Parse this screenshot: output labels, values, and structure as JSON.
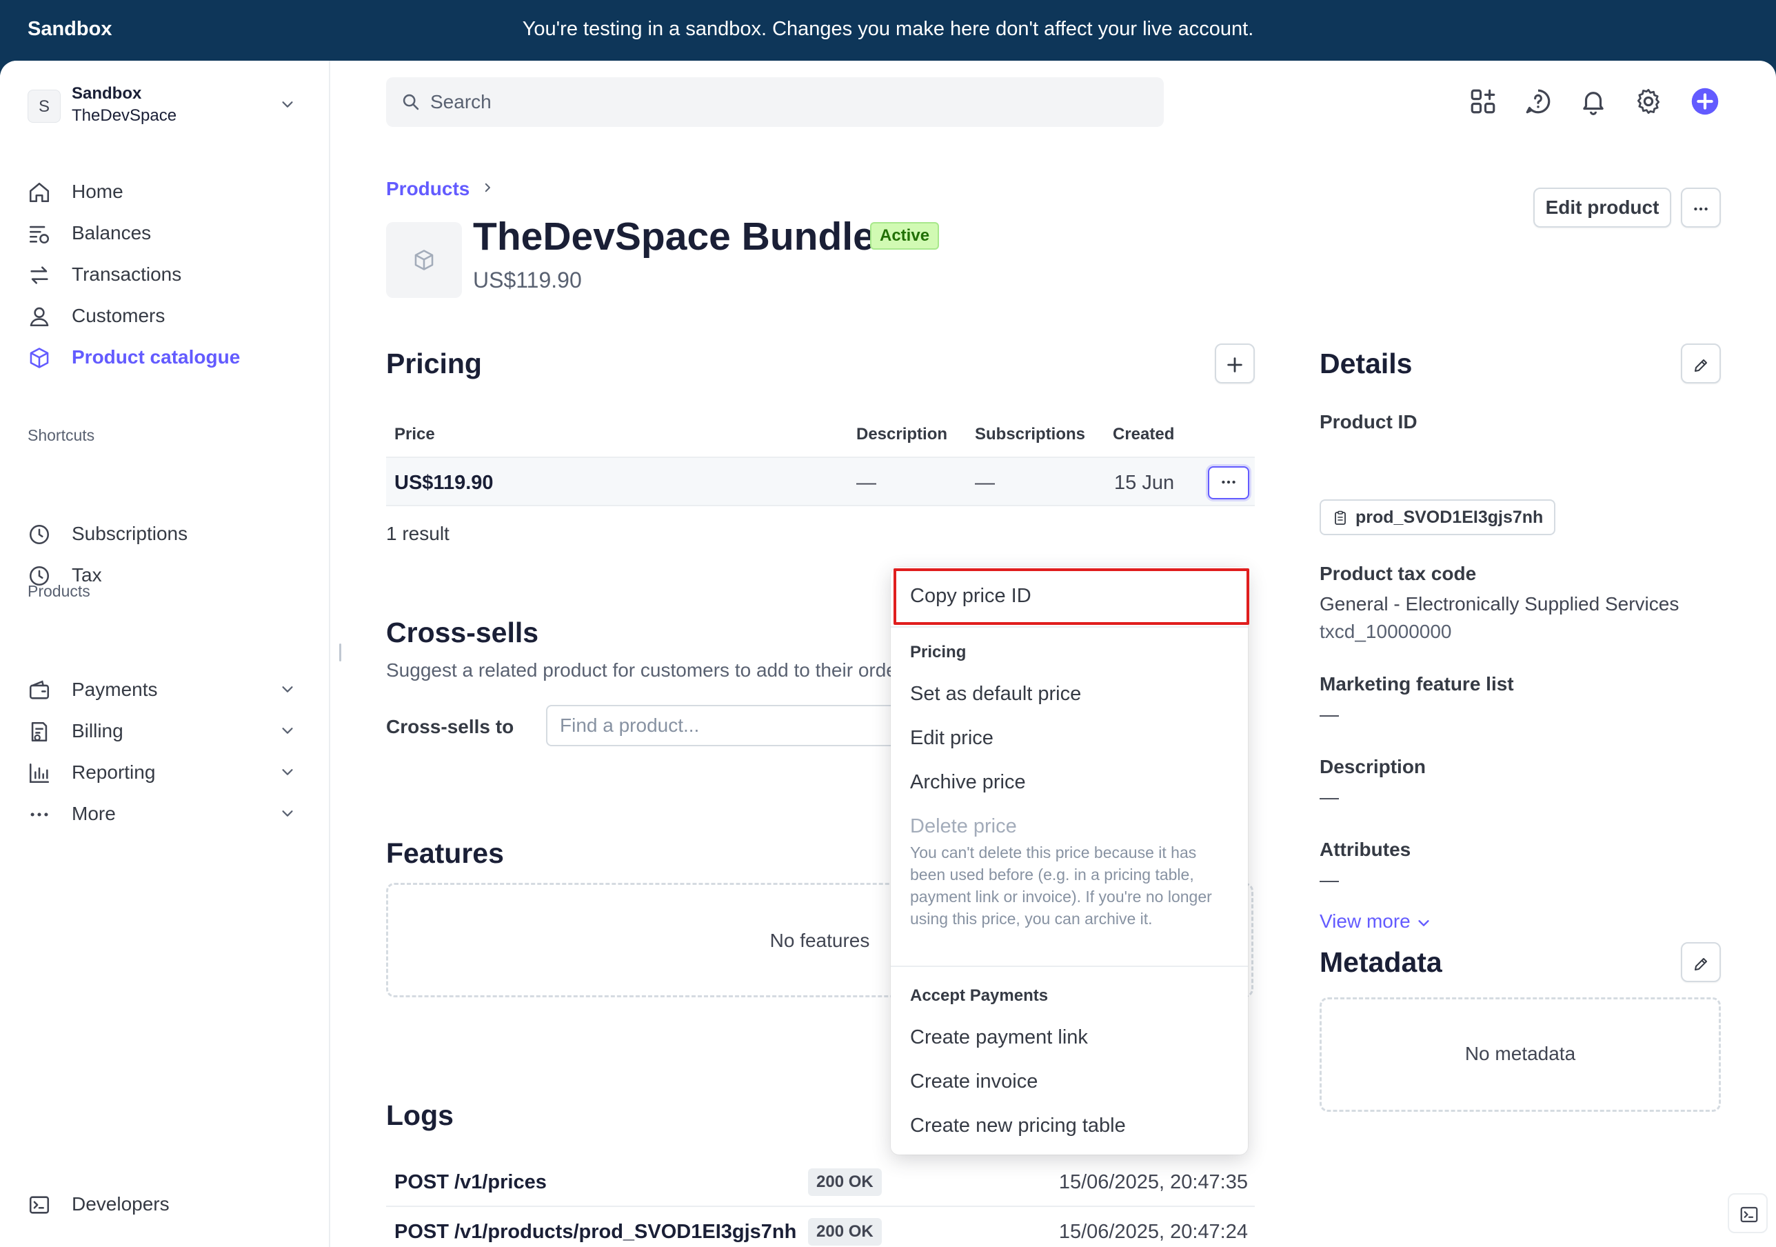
{
  "banner": {
    "brand": "Sandbox",
    "message": "You're testing in a sandbox. Changes you make here don't affect your live account."
  },
  "account": {
    "initial": "S",
    "name": "Sandbox",
    "org": "TheDevSpace"
  },
  "sidebar": {
    "items": [
      {
        "label": "Home",
        "icon": "home-icon"
      },
      {
        "label": "Balances",
        "icon": "balances-icon"
      },
      {
        "label": "Transactions",
        "icon": "transactions-icon"
      },
      {
        "label": "Customers",
        "icon": "customer-icon"
      },
      {
        "label": "Product catalogue",
        "icon": "product-cube-icon",
        "active": true
      }
    ],
    "shortcuts_heading": "Shortcuts",
    "shortcuts": [
      {
        "label": "Subscriptions",
        "icon": "clock-icon"
      },
      {
        "label": "Tax",
        "icon": "clock-icon"
      }
    ],
    "products_heading": "Products",
    "products": [
      {
        "label": "Payments",
        "icon": "wallet-icon"
      },
      {
        "label": "Billing",
        "icon": "billing-icon"
      },
      {
        "label": "Reporting",
        "icon": "chart-icon"
      },
      {
        "label": "More",
        "icon": "more-dots-icon"
      }
    ],
    "developers": "Developers"
  },
  "topbar": {
    "search_placeholder": "Search"
  },
  "header": {
    "breadcrumb": "Products",
    "title": "TheDevSpace Bundle",
    "status": "Active",
    "price": "US$119.90",
    "edit_label": "Edit product"
  },
  "pricing": {
    "heading": "Pricing",
    "columns": [
      "Price",
      "Description",
      "Subscriptions",
      "Created"
    ],
    "rows": [
      {
        "price": "US$119.90",
        "description": "—",
        "subscriptions": "—",
        "created": "15 Jun"
      }
    ],
    "result_count": "1 result"
  },
  "cross_sells": {
    "heading": "Cross-sells",
    "description": "Suggest a related product for customers to add to their order",
    "label": "Cross-sells to",
    "placeholder": "Find a product..."
  },
  "features": {
    "heading": "Features",
    "empty": "No features"
  },
  "logs": {
    "heading": "Logs",
    "rows": [
      {
        "endpoint": "POST /v1/prices",
        "status": "200 OK",
        "time": "15/06/2025, 20:47:35"
      },
      {
        "endpoint": "POST /v1/products/prod_SVOD1EI3gjs7nh",
        "status": "200 OK",
        "time": "15/06/2025, 20:47:24"
      }
    ]
  },
  "details": {
    "heading": "Details",
    "product_id_label": "Product ID",
    "product_id": "prod_SVOD1EI3gjs7nh",
    "tax_code_label": "Product tax code",
    "tax_code_name": "General - Electronically Supplied Services",
    "tax_code": "txcd_10000000",
    "marketing_label": "Marketing feature list",
    "marketing_value": "—",
    "description_label": "Description",
    "description_value": "—",
    "attributes_label": "Attributes",
    "attributes_value": "—",
    "view_more": "View more"
  },
  "metadata": {
    "heading": "Metadata",
    "empty": "No metadata"
  },
  "menu": {
    "copy_id": "Copy price ID",
    "pricing_heading": "Pricing",
    "set_default": "Set as default price",
    "edit_price": "Edit price",
    "archive_price": "Archive price",
    "delete_price": "Delete price",
    "delete_note": "You can't delete this price because it has been used before (e.g. in a pricing table, payment link or invoice). If you're no longer using this price, you can archive it.",
    "accept_heading": "Accept Payments",
    "create_link": "Create payment link",
    "create_invoice": "Create invoice",
    "create_table": "Create new pricing table"
  },
  "colors": {
    "accent": "#635bff",
    "banner": "#0e3659",
    "highlight": "#e01e1e",
    "badge_bg": "#d1fab3"
  }
}
